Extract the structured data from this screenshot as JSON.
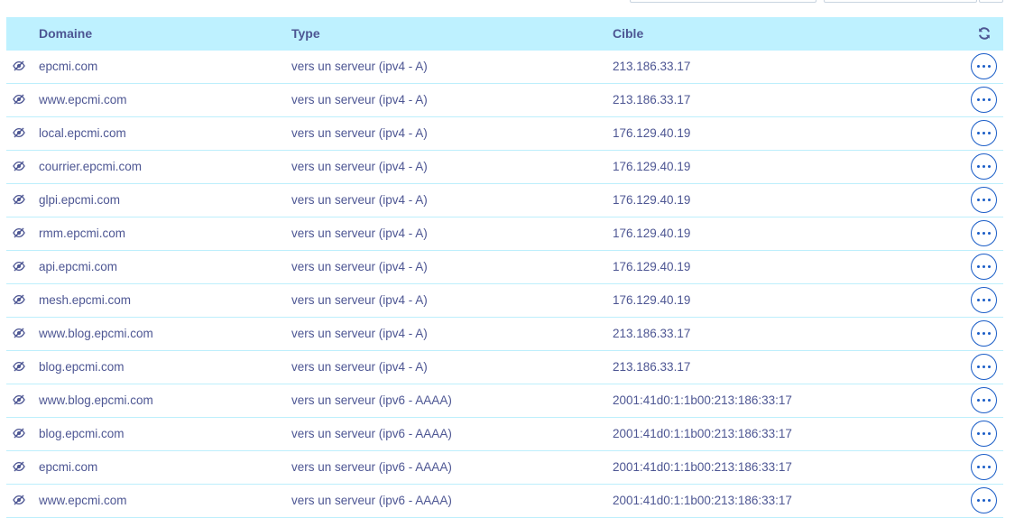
{
  "table": {
    "headers": {
      "domain": "Domaine",
      "type": "Type",
      "target": "Cible"
    },
    "refresh_icon": "refresh-icon",
    "row_icon": "eye-slash-icon",
    "action_icon": "ellipsis-icon",
    "rows": [
      {
        "domain": "epcmi.com",
        "type": "vers un serveur (ipv4 - A)",
        "target": "213.186.33.17"
      },
      {
        "domain": "www.epcmi.com",
        "type": "vers un serveur (ipv4 - A)",
        "target": "213.186.33.17"
      },
      {
        "domain": "local.epcmi.com",
        "type": "vers un serveur (ipv4 - A)",
        "target": "176.129.40.19"
      },
      {
        "domain": "courrier.epcmi.com",
        "type": "vers un serveur (ipv4 - A)",
        "target": "176.129.40.19"
      },
      {
        "domain": "glpi.epcmi.com",
        "type": "vers un serveur (ipv4 - A)",
        "target": "176.129.40.19"
      },
      {
        "domain": "rmm.epcmi.com",
        "type": "vers un serveur (ipv4 - A)",
        "target": "176.129.40.19"
      },
      {
        "domain": "api.epcmi.com",
        "type": "vers un serveur (ipv4 - A)",
        "target": "176.129.40.19"
      },
      {
        "domain": "mesh.epcmi.com",
        "type": "vers un serveur (ipv4 - A)",
        "target": "176.129.40.19"
      },
      {
        "domain": "www.blog.epcmi.com",
        "type": "vers un serveur (ipv4 - A)",
        "target": "213.186.33.17"
      },
      {
        "domain": "blog.epcmi.com",
        "type": "vers un serveur (ipv4 - A)",
        "target": "213.186.33.17"
      },
      {
        "domain": "www.blog.epcmi.com",
        "type": "vers un serveur (ipv6 - AAAA)",
        "target": "2001:41d0:1:1b00:213:186:33:17"
      },
      {
        "domain": "blog.epcmi.com",
        "type": "vers un serveur (ipv6 - AAAA)",
        "target": "2001:41d0:1:1b00:213:186:33:17"
      },
      {
        "domain": "epcmi.com",
        "type": "vers un serveur (ipv6 - AAAA)",
        "target": "2001:41d0:1:1b00:213:186:33:17"
      },
      {
        "domain": "www.epcmi.com",
        "type": "vers un serveur (ipv6 - AAAA)",
        "target": "2001:41d0:1:1b00:213:186:33:17"
      }
    ]
  }
}
